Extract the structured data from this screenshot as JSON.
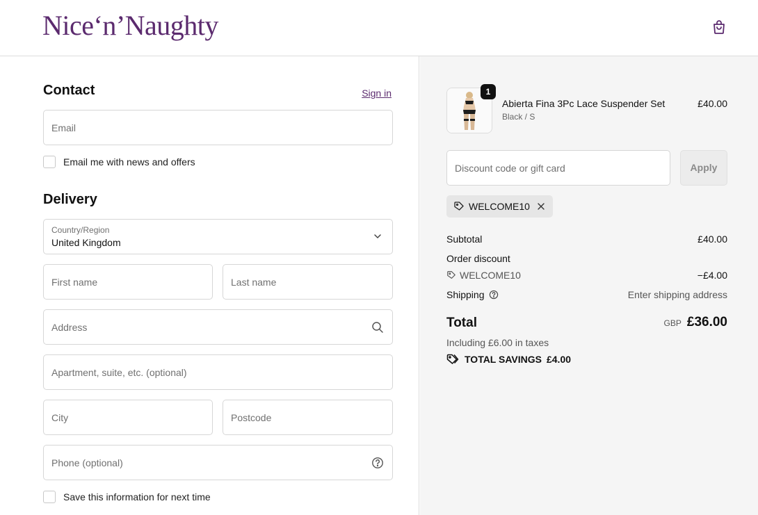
{
  "header": {
    "logo_text": "Nice‘n’Naughty",
    "cart_icon": "shopping-bag-icon",
    "brand_color": "#5b2a6e"
  },
  "contact": {
    "title": "Contact",
    "signin_label": "Sign in",
    "email_placeholder": "Email",
    "news_label": "Email me with news and offers"
  },
  "delivery": {
    "title": "Delivery",
    "country_label": "Country/Region",
    "country_value": "United Kingdom",
    "first_name_placeholder": "First name",
    "last_name_placeholder": "Last name",
    "address_placeholder": "Address",
    "apartment_placeholder": "Apartment, suite, etc. (optional)",
    "city_placeholder": "City",
    "postcode_placeholder": "Postcode",
    "phone_placeholder": "Phone (optional)",
    "save_info_label": "Save this information for next time"
  },
  "order": {
    "product": {
      "name": "Abierta Fina 3Pc Lace Suspender Set",
      "variant": "Black / S",
      "price": "£40.00",
      "quantity": "1"
    },
    "discount_placeholder": "Discount code or gift card",
    "apply_label": "Apply",
    "applied_code": "WELCOME10",
    "subtotal_label": "Subtotal",
    "subtotal_value": "£40.00",
    "order_discount_label": "Order discount",
    "discount_code": "WELCOME10",
    "discount_value": "−£4.00",
    "shipping_label": "Shipping",
    "shipping_value": "Enter shipping address",
    "total_label": "Total",
    "currency": "GBP",
    "total_value": "£36.00",
    "taxes_note": "Including £6.00 in taxes",
    "savings_label": "TOTAL SAVINGS",
    "savings_value": "£4.00"
  }
}
